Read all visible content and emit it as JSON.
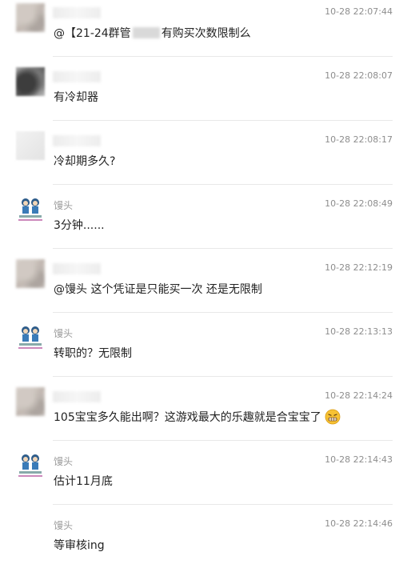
{
  "messages": [
    {
      "sender": "",
      "time": "10-28 22:07:44",
      "text_before": "@【21-24群管",
      "text_after": "有购买次数限制么"
    },
    {
      "sender": "",
      "time": "10-28 22:08:07",
      "text": "有冷却器"
    },
    {
      "sender": "",
      "time": "10-28 22:08:17",
      "text": "冷却期多久?"
    },
    {
      "sender": "馒头",
      "time": "10-28 22:08:49",
      "text": "3分钟......"
    },
    {
      "sender": "",
      "time": "10-28 22:12:19",
      "text": "@馒头 这个凭证是只能买一次  还是无限制"
    },
    {
      "sender": "馒头",
      "time": "10-28 22:13:13",
      "text": "转职的？无限制"
    },
    {
      "sender": "",
      "time": "10-28 22:14:24",
      "text": "105宝宝多久能出啊？这游戏最大的乐趣就是合宝宝了"
    },
    {
      "sender": "馒头",
      "time": "10-28 22:14:43",
      "text": "估计11月底"
    },
    {
      "sender": "馒头",
      "time": "10-28 22:14:46",
      "text": "等审核ing"
    }
  ]
}
